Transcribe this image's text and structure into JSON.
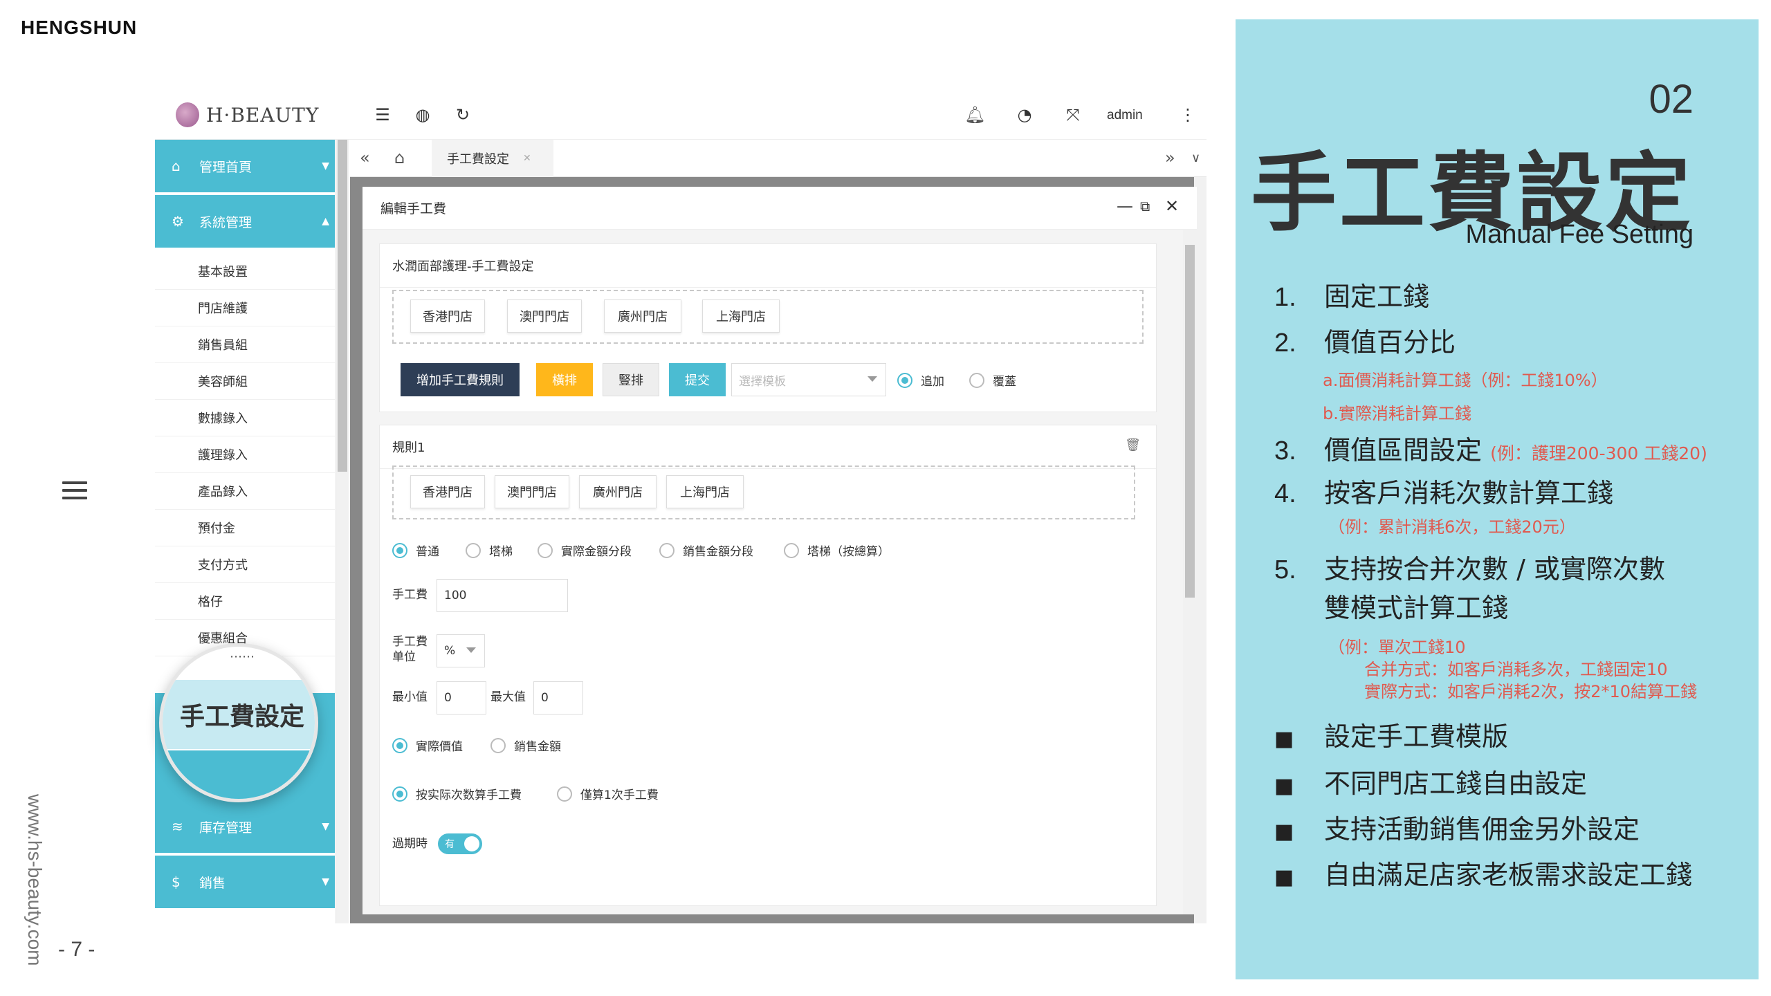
{
  "brand": "HENGSHUN",
  "website": "www.hs-beauty.com",
  "page_number": "- 7 -",
  "app": {
    "logo": "H·BEAUTY",
    "user": "admin",
    "tab_label": "手工費設定",
    "sidebar": {
      "main_home": "管理首頁",
      "main_system": "系統管理",
      "sub_items": [
        "基本設置",
        "門店維護",
        "銷售員組",
        "美容師組",
        "數據錄入",
        "護理錄入",
        "產品錄入",
        "預付金",
        "支付方式",
        "格仔",
        "優惠組合"
      ],
      "highlight": "手工費設定",
      "main_stock": "庫存管理",
      "main_sales": "銷售"
    },
    "dialog": {
      "title": "編輯手工費",
      "section_title": "水潤面部護理-手工費設定",
      "stores": [
        "香港門店",
        "澳門門店",
        "廣州門店",
        "上海門店"
      ],
      "btn_add_rule": "增加手工費規則",
      "btn_horizontal": "橫排",
      "btn_vertical": "豎排",
      "btn_submit": "提交",
      "template_placeholder": "選擇模板",
      "radio_append": "追加",
      "radio_overwrite": "覆蓋",
      "rule_title": "規則1",
      "rule_stores": [
        "香港門店",
        "澳門門店",
        "廣州門店",
        "上海門店"
      ],
      "fee_types": [
        "普通",
        "塔梯",
        "實際金額分段",
        "銷售金額分段",
        "塔梯（按總算）"
      ],
      "fee_label": "手工費",
      "fee_value": "100",
      "unit_label_1": "手工費",
      "unit_label_2": "单位",
      "unit_value": "%",
      "min_label": "最小值",
      "min_value": "0",
      "max_label": "最大值",
      "max_value": "0",
      "value_types": [
        "實際價值",
        "銷售金額"
      ],
      "count_types": [
        "按实际次数算手工費",
        "僅算1次手工費"
      ],
      "expiry_label": "過期時",
      "expiry_toggle": "有"
    }
  },
  "panel": {
    "number": "02",
    "title": "手工費設定",
    "subtitle": "Manual Fee Setting",
    "items": [
      {
        "num": "1.",
        "text": "固定工錢"
      },
      {
        "num": "2.",
        "text": "價值百分比"
      },
      {
        "num": "3.",
        "text": "價值區間設定",
        "inline_note": "(例：護理200-300 工錢20)"
      },
      {
        "num": "4.",
        "text": "按客戶消耗次數計算工錢"
      },
      {
        "num": "5.",
        "text": "支持按合并次數 / 或實際次數",
        "text2": "雙模式計算工錢"
      }
    ],
    "notes": {
      "n2a": "a.面價消耗計算工錢（例：工錢10%）",
      "n2b": "b.實際消耗計算工錢",
      "n4": "（例：累計消耗6次，工錢20元）",
      "n5a": "（例：單次工錢10",
      "n5b": "合并方式：如客戶消耗多次，工錢固定10",
      "n5c": "實際方式：如客戶消耗2次，按2*10結算工錢"
    },
    "bullets": [
      "設定手工費模版",
      "不同門店工錢自由設定",
      "支持活動銷售佣金另外設定",
      "自由滿足店家老板需求設定工錢"
    ]
  },
  "colors": {
    "accent": "#4bbcd2",
    "panel_bg": "#a5dfe9",
    "dark_button": "#2e3e56",
    "orange_button": "#ffb71b",
    "note_red": "#e05a4f"
  }
}
